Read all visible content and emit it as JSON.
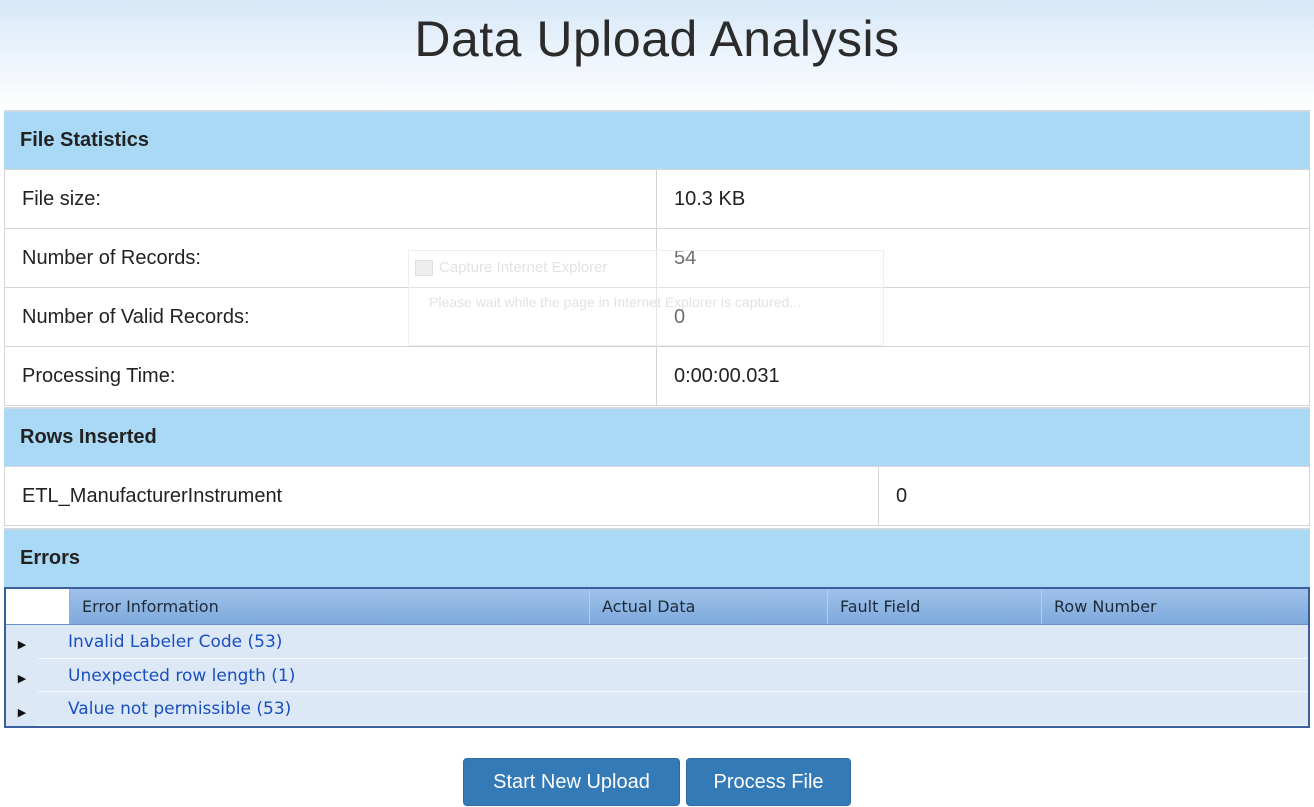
{
  "page": {
    "title": "Data Upload Analysis"
  },
  "file_statistics": {
    "header": "File Statistics",
    "rows": [
      {
        "label": "File size:",
        "value": "10.3 KB"
      },
      {
        "label": "Number of Records:",
        "value": "54"
      },
      {
        "label": "Number of Valid Records:",
        "value": "0"
      },
      {
        "label": "Processing Time:",
        "value": "0:00:00.031"
      }
    ]
  },
  "rows_inserted": {
    "header": "Rows Inserted",
    "rows": [
      {
        "label": "ETL_ManufacturerInstrument",
        "value": "0"
      }
    ]
  },
  "errors": {
    "header": "Errors",
    "columns": [
      "Error Information",
      "Actual Data",
      "Fault Field",
      "Row Number"
    ],
    "groups": [
      {
        "label": "Invalid Labeler Code (53)"
      },
      {
        "label": "Unexpected row length (1)"
      },
      {
        "label": "Value not permissible (53)"
      }
    ]
  },
  "buttons": {
    "start_new_upload": "Start New Upload",
    "process_file": "Process File"
  },
  "overlay": {
    "title": "Capture Internet Explorer",
    "message": "Please wait while the page in Internet Explorer is captured..."
  },
  "colors": {
    "section_header": "#a9d9f5",
    "button": "#337ab7",
    "link": "#1a4fbf",
    "grid_header": "#7ea9dc"
  }
}
